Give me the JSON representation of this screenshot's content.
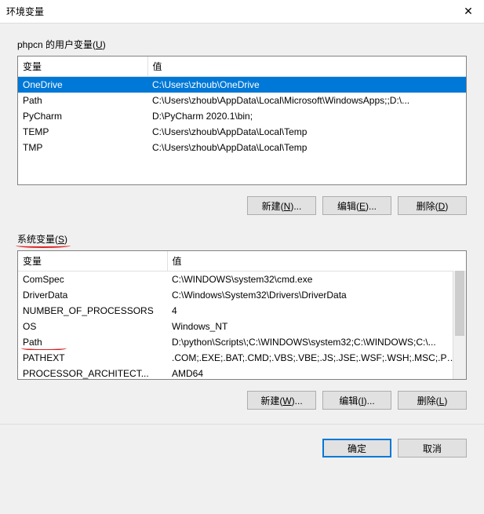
{
  "window": {
    "title": "环境变量"
  },
  "user": {
    "label_prefix": "phpcn 的用户变量(",
    "label_key": "U",
    "label_suffix": ")",
    "col_var": "变量",
    "col_val": "值",
    "rows": [
      {
        "name": "OneDrive",
        "value": "C:\\Users\\zhoub\\OneDrive",
        "selected": true
      },
      {
        "name": "Path",
        "value": "C:\\Users\\zhoub\\AppData\\Local\\Microsoft\\WindowsApps;;D:\\..."
      },
      {
        "name": "PyCharm",
        "value": "D:\\PyCharm 2020.1\\bin;"
      },
      {
        "name": "TEMP",
        "value": "C:\\Users\\zhoub\\AppData\\Local\\Temp"
      },
      {
        "name": "TMP",
        "value": "C:\\Users\\zhoub\\AppData\\Local\\Temp"
      }
    ],
    "btn_new_pre": "新建(",
    "btn_new_key": "N",
    "btn_new_suf": ")...",
    "btn_edit_pre": "编辑(",
    "btn_edit_key": "E",
    "btn_edit_suf": ")...",
    "btn_del_pre": "删除(",
    "btn_del_key": "D",
    "btn_del_suf": ")"
  },
  "sys": {
    "label_prefix": "系统变量(",
    "label_key": "S",
    "label_suffix": ")",
    "col_var": "变量",
    "col_val": "值",
    "rows": [
      {
        "name": "ComSpec",
        "value": "C:\\WINDOWS\\system32\\cmd.exe"
      },
      {
        "name": "DriverData",
        "value": "C:\\Windows\\System32\\Drivers\\DriverData"
      },
      {
        "name": "NUMBER_OF_PROCESSORS",
        "value": "4"
      },
      {
        "name": "OS",
        "value": "Windows_NT"
      },
      {
        "name": "Path",
        "value": "D:\\python\\Scripts\\;C:\\WINDOWS\\system32;C:\\WINDOWS;C:\\...",
        "annot": true
      },
      {
        "name": "PATHEXT",
        "value": ".COM;.EXE;.BAT;.CMD;.VBS;.VBE;.JS;.JSE;.WSF;.WSH;.MSC;.PY;.P..."
      },
      {
        "name": "PROCESSOR_ARCHITECT...",
        "value": "AMD64"
      }
    ],
    "btn_new_pre": "新建(",
    "btn_new_key": "W",
    "btn_new_suf": ")...",
    "btn_edit_pre": "编辑(",
    "btn_edit_key": "I",
    "btn_edit_suf": ")...",
    "btn_del_pre": "删除(",
    "btn_del_key": "L",
    "btn_del_suf": ")"
  },
  "footer": {
    "ok": "确定",
    "cancel": "取消"
  }
}
